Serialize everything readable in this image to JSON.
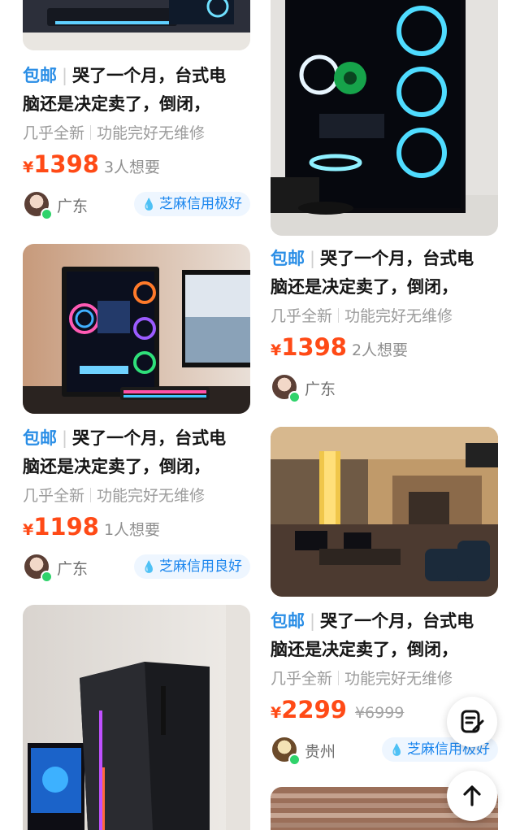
{
  "items": [
    {
      "tag": "包邮",
      "title_line1": "哭了一个月，台式电",
      "title_line2": "脑还是决定卖了，倒闭，",
      "attr1": "几乎全新",
      "attr2": "功能完好无维修",
      "currency": "¥",
      "price": "1398",
      "wants": "3人想要",
      "location": "广东",
      "credit": "芝麻信用极好"
    },
    {
      "tag": "包邮",
      "title_line1": "哭了一个月，台式电",
      "title_line2": "脑还是决定卖了，倒闭，",
      "attr1": "几乎全新",
      "attr2": "功能完好无维修",
      "currency": "¥",
      "price": "1398",
      "wants": "2人想要",
      "location": "广东"
    },
    {
      "tag": "包邮",
      "title_line1": "哭了一个月，台式电",
      "title_line2": "脑还是决定卖了，倒闭，",
      "attr1": "几乎全新",
      "attr2": "功能完好无维修",
      "currency": "¥",
      "price": "1198",
      "wants": "1人想要",
      "location": "广东",
      "credit": "芝麻信用良好"
    },
    {
      "tag": "包邮",
      "title_line1": "哭了一个月，台式电",
      "title_line2": "脑还是决定卖了，倒闭，",
      "attr1": "几乎全新",
      "attr2": "功能完好无维修",
      "currency": "¥",
      "price": "2299",
      "original_price": "¥6999",
      "location": "贵州",
      "credit": "芝麻信用极好"
    }
  ],
  "colors": {
    "accent_blue": "#2a8ee6",
    "price_red": "#ff4a16",
    "online_green": "#2fd36b"
  },
  "icons": [
    "edit-note-icon",
    "arrow-up-icon",
    "sesame-credit-icon"
  ]
}
